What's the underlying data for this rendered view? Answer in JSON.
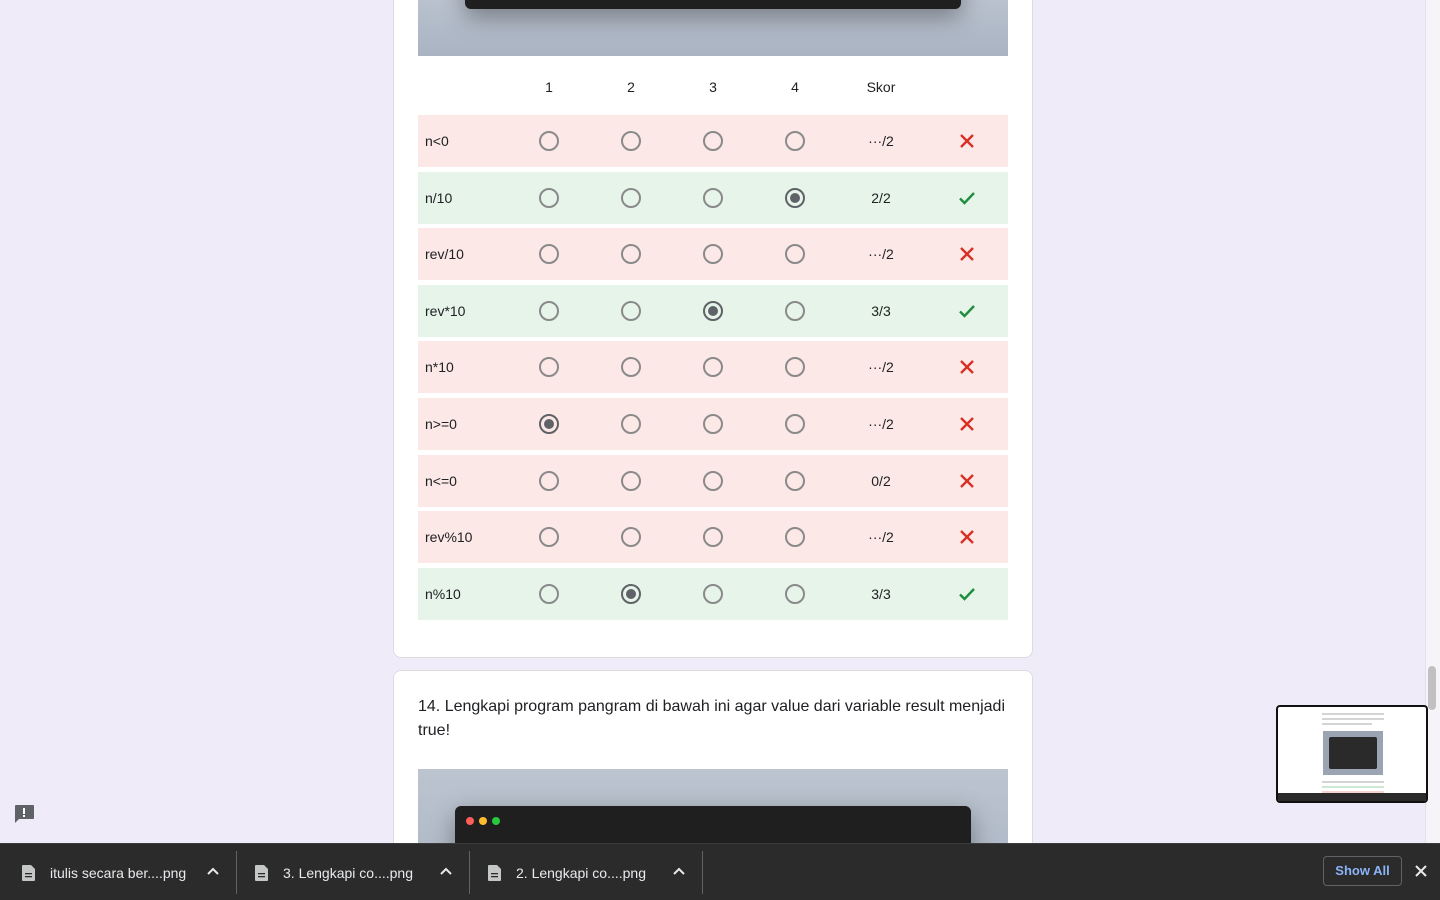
{
  "grid": {
    "columns": [
      "1",
      "2",
      "3",
      "4"
    ],
    "score_header": "Skor",
    "rows": [
      {
        "label": "n<0",
        "selected": null,
        "score": "···/2",
        "correct": false
      },
      {
        "label": "n/10",
        "selected": 4,
        "score": "2/2",
        "correct": true
      },
      {
        "label": "rev/10",
        "selected": null,
        "score": "···/2",
        "correct": false
      },
      {
        "label": "rev*10",
        "selected": 3,
        "score": "3/3",
        "correct": true
      },
      {
        "label": "n*10",
        "selected": null,
        "score": "···/2",
        "correct": false
      },
      {
        "label": "n>=0",
        "selected": 1,
        "score": "···/2",
        "correct": false
      },
      {
        "label": "n<=0",
        "selected": null,
        "score": "0/2",
        "correct": false
      },
      {
        "label": "rev%10",
        "selected": null,
        "score": "···/2",
        "correct": false
      },
      {
        "label": "n%10",
        "selected": 2,
        "score": "3/3",
        "correct": true
      }
    ]
  },
  "question14": {
    "title": "14. Lengkapi program pangram di bawah ini agar value dari variable result menjadi true!"
  },
  "downloads": {
    "items": [
      {
        "name": "itulis secara ber....png"
      },
      {
        "name": "3. Lengkapi co....png"
      },
      {
        "name": "2. Lengkapi co....png"
      }
    ],
    "show_all_label": "Show All"
  },
  "colors": {
    "wrong_bg": "#fce8e6",
    "correct_bg": "#e6f4ea",
    "wrong_mark": "#d93025",
    "correct_mark": "#1e8e3e",
    "page_bg": "#f0ebf8"
  },
  "icons": {
    "correct": "check-icon",
    "wrong": "close-icon",
    "file": "file-icon",
    "caret": "chevron-up-icon",
    "feedback": "feedback-icon"
  }
}
